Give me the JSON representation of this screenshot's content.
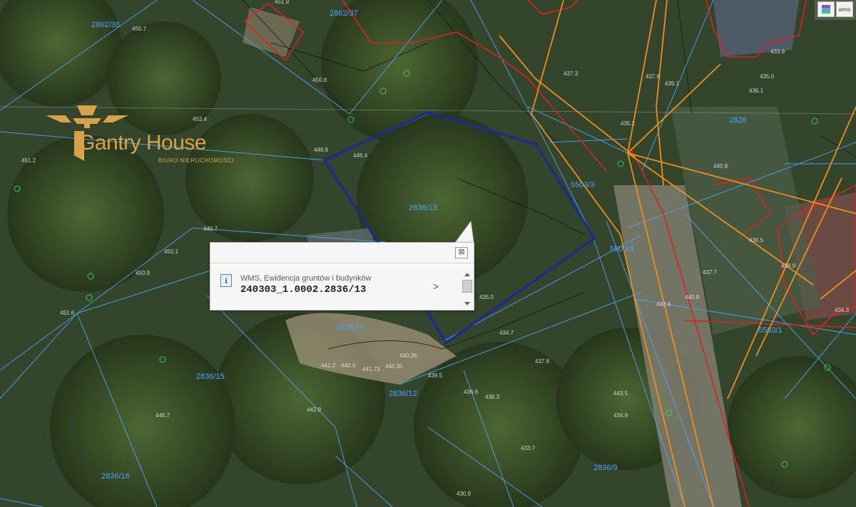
{
  "logo": {
    "brand": "Gantry House",
    "tagline": "BIURO NIERUCHOMOŚCI"
  },
  "toolbar": {
    "layers_icon": "layers-icon",
    "wms_label": "wms"
  },
  "parcels": [
    {
      "id": "2862/38",
      "name": "parcel-2862-38"
    },
    {
      "id": "2862/37",
      "name": "parcel-2862-37"
    },
    {
      "id": "2828",
      "name": "parcel-2828"
    },
    {
      "id": "2836/13",
      "name": "parcel-2836-13"
    },
    {
      "id": "5503/3",
      "name": "parcel-5503-3"
    },
    {
      "id": "5503/4",
      "name": "parcel-5503-4"
    },
    {
      "id": "5503/1",
      "name": "parcel-5503-1"
    },
    {
      "id": "2836/14",
      "name": "parcel-2836-14"
    },
    {
      "id": "2836/15",
      "name": "parcel-2836-15"
    },
    {
      "id": "2836/12",
      "name": "parcel-2836-12"
    },
    {
      "id": "2836/16",
      "name": "parcel-2836-16"
    },
    {
      "id": "2836/9",
      "name": "parcel-2836-9"
    }
  ],
  "heights": [
    "450.7",
    "451.9",
    "450.8",
    "453.4",
    "451.2",
    "448.8",
    "446.4",
    "449.7",
    "450.1",
    "450.9",
    "451.6",
    "446.7",
    "442.9",
    "441.3",
    "440.4",
    "441.73",
    "440.35",
    "440.36",
    "439.5",
    "436.6",
    "437.8",
    "434.9",
    "435.0",
    "434.7",
    "438.3",
    "433.7",
    "430.9",
    "443.5",
    "442.4",
    "440.9",
    "437.7",
    "436.1",
    "435.0",
    "433.9",
    "439.1",
    "437.6",
    "435.1",
    "438.9",
    "434.3",
    "436.5",
    "437.3",
    "440.8"
  ],
  "popup": {
    "close_label": "⊠",
    "layer_title": "WMS, Ewidencja gruntów i budynków",
    "parcel_id": "240303_1.0002.2836/13",
    "next_label": ">"
  },
  "colors": {
    "parcel_lines": "#4aa3ff",
    "selected_parcel": "#1f2a8f",
    "building_lines": "#e02020",
    "utility_lines": "#f08c1a",
    "logo": "#d8a24a"
  }
}
